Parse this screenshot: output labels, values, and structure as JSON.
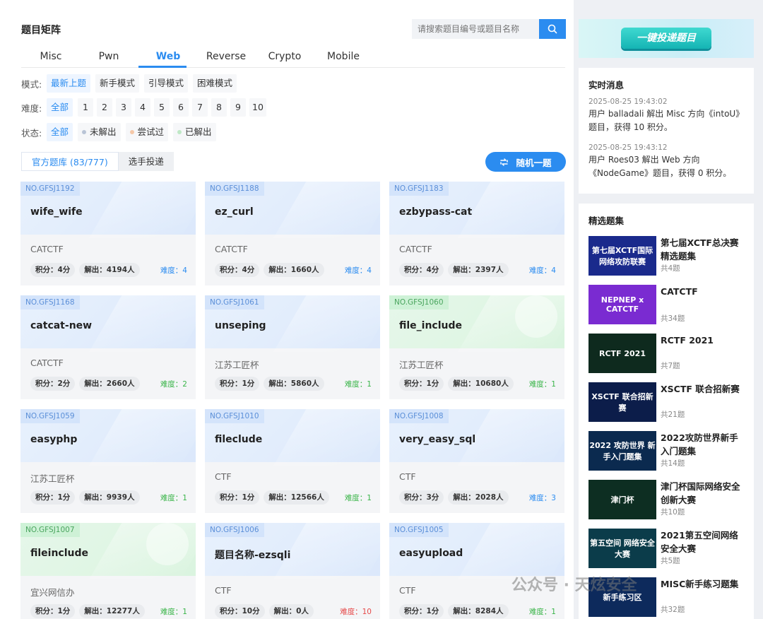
{
  "title": "题目矩阵",
  "search": {
    "placeholder": "请搜索题目编号或题目名称"
  },
  "tabs": [
    "Misc",
    "Pwn",
    "Web",
    "Reverse",
    "Crypto",
    "Mobile"
  ],
  "active_tab": "Web",
  "filters": {
    "mode_label": "模式:",
    "modes": [
      "最新上题",
      "新手模式",
      "引导模式",
      "困难模式"
    ],
    "difficulty_label": "难度:",
    "difficulties": [
      "全部",
      "1",
      "2",
      "3",
      "4",
      "5",
      "6",
      "7",
      "8",
      "9",
      "10"
    ],
    "status_label": "状态:",
    "statuses": [
      "全部",
      "未解出",
      "尝试过",
      "已解出"
    ]
  },
  "subtabs": [
    "官方题库 (83/777)",
    "选手投递"
  ],
  "random_button": "随机一题",
  "cards": [
    {
      "no": "NO.GFSJ1192",
      "title": "wife_wife",
      "source": "CATCTF",
      "score": "积分：4分",
      "solved": "解出：4194人",
      "difficulty": "难度：4",
      "diff_color": "#2b8cf0",
      "theme": "blue"
    },
    {
      "no": "NO.GFSJ1188",
      "title": "ez_curl",
      "source": "CATCTF",
      "score": "积分：4分",
      "solved": "解出：1660人",
      "difficulty": "难度：4",
      "diff_color": "#2b8cf0",
      "theme": "blue"
    },
    {
      "no": "NO.GFSJ1183",
      "title": "ezbypass-cat",
      "source": "CATCTF",
      "score": "积分：4分",
      "solved": "解出：2397人",
      "difficulty": "难度：4",
      "diff_color": "#2b8cf0",
      "theme": "blue"
    },
    {
      "no": "NO.GFSJ1168",
      "title": "catcat-new",
      "source": "CATCTF",
      "score": "积分：2分",
      "solved": "解出：2660人",
      "difficulty": "难度：2",
      "diff_color": "#3bb54a",
      "theme": "blue"
    },
    {
      "no": "NO.GFSJ1061",
      "title": "unseping",
      "source": "江苏工匠杯",
      "score": "积分：1分",
      "solved": "解出：5860人",
      "difficulty": "难度：1",
      "diff_color": "#3bb54a",
      "theme": "blue"
    },
    {
      "no": "NO.GFSJ1060",
      "title": "file_include",
      "source": "江苏工匠杯",
      "score": "积分：1分",
      "solved": "解出：10680人",
      "difficulty": "难度：1",
      "diff_color": "#3bb54a",
      "theme": "green"
    },
    {
      "no": "NO.GFSJ1059",
      "title": "easyphp",
      "source": "江苏工匠杯",
      "score": "积分：1分",
      "solved": "解出：9939人",
      "difficulty": "难度：1",
      "diff_color": "#3bb54a",
      "theme": "blue"
    },
    {
      "no": "NO.GFSJ1010",
      "title": "fileclude",
      "source": "CTF",
      "score": "积分：1分",
      "solved": "解出：12566人",
      "difficulty": "难度：1",
      "diff_color": "#3bb54a",
      "theme": "blue"
    },
    {
      "no": "NO.GFSJ1008",
      "title": "very_easy_sql",
      "source": "CTF",
      "score": "积分：3分",
      "solved": "解出：2028人",
      "difficulty": "难度：3",
      "diff_color": "#2b8cf0",
      "theme": "blue"
    },
    {
      "no": "NO.GFSJ1007",
      "title": "fileinclude",
      "source": "宜兴网信办",
      "score": "积分：1分",
      "solved": "解出：12277人",
      "difficulty": "难度：1",
      "diff_color": "#3bb54a",
      "theme": "green"
    },
    {
      "no": "NO.GFSJ1006",
      "title": "题目名称-ezsqli",
      "source": "CTF",
      "score": "积分：10分",
      "solved": "解出：0人",
      "difficulty": "难度：10",
      "diff_color": "#e64a4a",
      "theme": "blue"
    },
    {
      "no": "NO.GFSJ1005",
      "title": "easyupload",
      "source": "CTF",
      "score": "积分：1分",
      "solved": "解出：8284人",
      "difficulty": "难度：1",
      "diff_color": "#3bb54a",
      "theme": "blue"
    }
  ],
  "banner": {
    "text": "一键投递题目"
  },
  "realtime": {
    "title": "实时消息",
    "items": [
      {
        "time": "2025-08-25 19:43:02",
        "text": "用户 balladali 解出 Misc 方向《intoU》题目，获得 10 积分。"
      },
      {
        "time": "2025-08-25 19:43:12",
        "text": "用户 Roes03 解出 Web 方向《NodeGame》题目，获得 0 积分。"
      }
    ]
  },
  "featured": {
    "title": "精选题集",
    "items": [
      {
        "name": "第七届XCTF总决赛精选题集",
        "count": "共4题",
        "thumb_text": "第七届XCTF国际网络攻防联赛",
        "thumb_bg": "#1a2a8c"
      },
      {
        "name": "CATCTF",
        "count": "共34题",
        "thumb_text": "NEPNEP x CATCTF",
        "thumb_bg": "#7a2bd1"
      },
      {
        "name": "RCTF 2021",
        "count": "共7题",
        "thumb_text": "RCTF 2021",
        "thumb_bg": "#0e2a1e"
      },
      {
        "name": "XSCTF 联合招新赛",
        "count": "共21题",
        "thumb_text": "XSCTF 联合招新赛",
        "thumb_bg": "#0c1d4a"
      },
      {
        "name": "2022攻防世界新手入门题集",
        "count": "共14题",
        "thumb_text": "2022 攻防世界 新手入门题集",
        "thumb_bg": "#0b2a4f"
      },
      {
        "name": "津门杯国际网络安全创新大赛",
        "count": "共10题",
        "thumb_text": "津门杯",
        "thumb_bg": "#0d2e22"
      },
      {
        "name": "2021第五空间网络安全大赛",
        "count": "共5题",
        "thumb_text": "第五空间 网络安全大赛",
        "thumb_bg": "#0b3c4a"
      },
      {
        "name": "MISC新手练习题集",
        "count": "共32题",
        "thumb_text": "新手练习区",
        "thumb_bg": "#0d2a5c"
      }
    ]
  },
  "watermark": "公众号 · 天炫安全"
}
